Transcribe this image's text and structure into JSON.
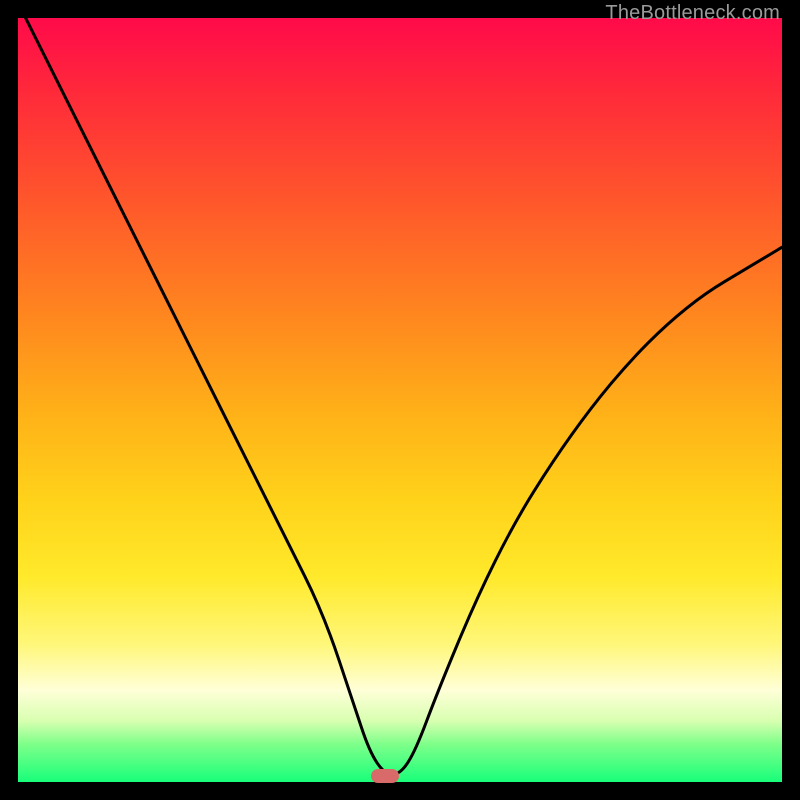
{
  "watermark": {
    "text": "TheBottleneck.com"
  },
  "marker": {
    "x_pct": 48,
    "y_pct": 99.2
  },
  "chart_data": {
    "type": "line",
    "title": "",
    "xlabel": "",
    "ylabel": "",
    "xlim": [
      0,
      100
    ],
    "ylim": [
      0,
      100
    ],
    "grid": false,
    "legend": false,
    "series": [
      {
        "name": "bottleneck-curve",
        "x": [
          0,
          5,
          10,
          15,
          20,
          25,
          30,
          35,
          40,
          44,
          46,
          48,
          50,
          52,
          55,
          60,
          65,
          70,
          75,
          80,
          85,
          90,
          95,
          100
        ],
        "values": [
          102,
          92,
          82,
          72,
          62,
          52,
          42,
          32,
          22,
          10,
          4,
          1,
          1,
          4,
          12,
          24,
          34,
          42,
          49,
          55,
          60,
          64,
          67,
          70
        ]
      }
    ],
    "background_gradient": {
      "stops": [
        {
          "pct": 0,
          "color": "#ff0a4a"
        },
        {
          "pct": 10,
          "color": "#ff2a3a"
        },
        {
          "pct": 25,
          "color": "#ff5a2a"
        },
        {
          "pct": 40,
          "color": "#ff8a1e"
        },
        {
          "pct": 52,
          "color": "#ffb218"
        },
        {
          "pct": 63,
          "color": "#ffd21a"
        },
        {
          "pct": 73,
          "color": "#ffe92a"
        },
        {
          "pct": 82,
          "color": "#fff77a"
        },
        {
          "pct": 88,
          "color": "#ffffd8"
        },
        {
          "pct": 92,
          "color": "#d8ffb0"
        },
        {
          "pct": 95,
          "color": "#7fff8a"
        },
        {
          "pct": 100,
          "color": "#18ff7a"
        }
      ]
    },
    "marker": {
      "x": 48,
      "y": 0.8,
      "color": "#d86a6a"
    }
  }
}
